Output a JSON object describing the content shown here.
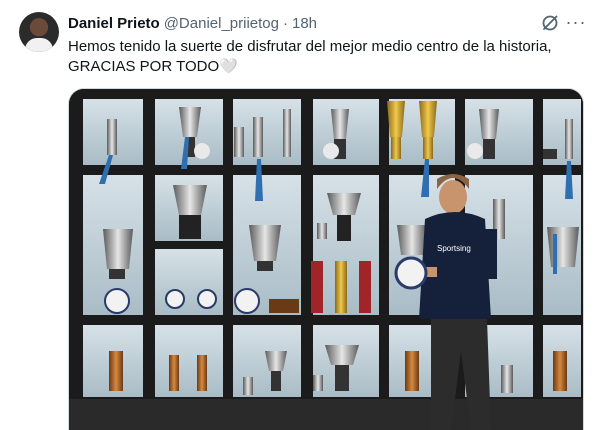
{
  "author": {
    "name": "Daniel Prieto",
    "handle": "@Daniel_priietog",
    "separator": "·",
    "time": "18h"
  },
  "tweet": {
    "line1": "Hemos tenido la suerte de disfrutar del mejor medio centro de la historia,",
    "line2": "GRACIAS POR TODO",
    "heart": "🤍"
  },
  "icons": {
    "grok": "grok-icon",
    "more": "more-icon",
    "more_glyph": "···"
  },
  "media": {
    "shirt_text": "Sportsing"
  }
}
